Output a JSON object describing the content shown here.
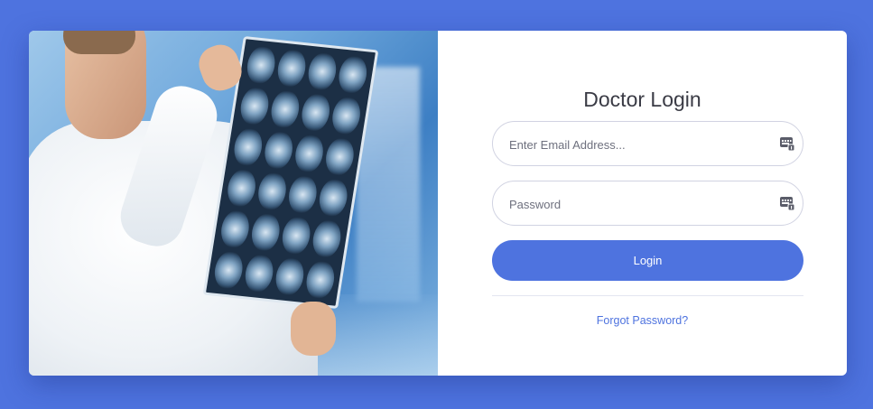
{
  "form": {
    "title": "Doctor Login",
    "email_placeholder": "Enter Email Address...",
    "email_value": "",
    "password_placeholder": "Password",
    "password_value": "",
    "login_label": "Login",
    "forgot_label": "Forgot Password?"
  },
  "icons": {
    "email_field_icon": "password-manager-keyboard-icon",
    "password_field_icon": "password-manager-keyboard-icon"
  },
  "colors": {
    "background": "#4e73df",
    "button": "#4e73df",
    "link": "#4e73df",
    "card": "#ffffff"
  }
}
